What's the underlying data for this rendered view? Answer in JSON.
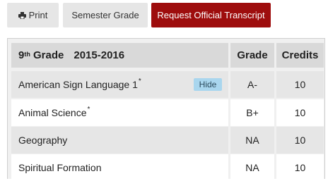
{
  "toolbar": {
    "print_label": "Print",
    "print_icon": "printer-icon",
    "semester_label": "Semester Grade",
    "transcript_label": "Request Official Transcript"
  },
  "colors": {
    "transcript_button": "#9e0d0d",
    "hide_button": "#a9d6ee",
    "header_cell": "#d9d9d9",
    "row_shade": "#e6e6e6"
  },
  "table": {
    "grade_level": "9",
    "grade_suffix": "th",
    "grade_word": "Grade",
    "year": "2015-2016",
    "col_grade": "Grade",
    "col_credits": "Credits",
    "hide_label": "Hide",
    "rows": [
      {
        "course": "American Sign Language 1",
        "marker": "*",
        "grade": "A-",
        "credits": "10"
      },
      {
        "course": "Animal Science",
        "marker": "*",
        "grade": "B+",
        "credits": "10"
      },
      {
        "course": "Geography",
        "marker": "",
        "grade": "NA",
        "credits": "10"
      },
      {
        "course": "Spiritual Formation",
        "marker": "",
        "grade": "NA",
        "credits": "10"
      }
    ]
  }
}
